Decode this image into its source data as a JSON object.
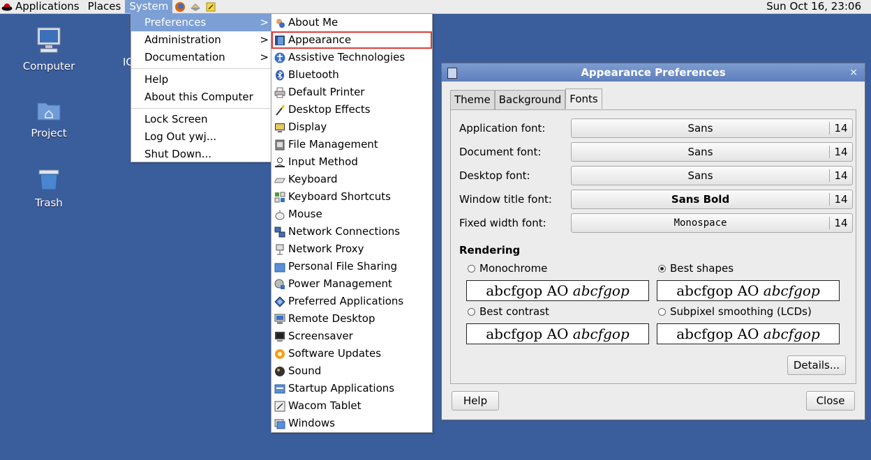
{
  "panel": {
    "applications": "Applications",
    "places": "Places",
    "system": "System",
    "clock": "Sun Oct 16, 23:06"
  },
  "desktop": {
    "icons": [
      {
        "label": "Computer",
        "icon": "computer-icon"
      },
      {
        "label": "Project",
        "icon": "folder-icon"
      },
      {
        "label": "Trash",
        "icon": "trash-icon"
      }
    ],
    "partial_label": "IC"
  },
  "system_menu": {
    "items": [
      "Preferences",
      "Administration",
      "Documentation",
      "Help",
      "About this Computer",
      "Lock Screen",
      "Log Out ywj...",
      "Shut Down..."
    ],
    "arrow": ">"
  },
  "preferences_menu": {
    "items": [
      {
        "label": "About Me",
        "icon": "about-me-icon"
      },
      {
        "label": "Appearance",
        "icon": "appearance-icon"
      },
      {
        "label": "Assistive Technologies",
        "icon": "accessibility-icon"
      },
      {
        "label": "Bluetooth",
        "icon": "bluetooth-icon"
      },
      {
        "label": "Default Printer",
        "icon": "printer-icon"
      },
      {
        "label": "Desktop Effects",
        "icon": "desktop-effects-icon"
      },
      {
        "label": "Display",
        "icon": "display-icon"
      },
      {
        "label": "File Management",
        "icon": "file-management-icon"
      },
      {
        "label": "Input Method",
        "icon": "input-method-icon"
      },
      {
        "label": "Keyboard",
        "icon": "keyboard-icon"
      },
      {
        "label": "Keyboard Shortcuts",
        "icon": "keyboard-shortcuts-icon"
      },
      {
        "label": "Mouse",
        "icon": "mouse-icon"
      },
      {
        "label": "Network Connections",
        "icon": "network-connections-icon"
      },
      {
        "label": "Network Proxy",
        "icon": "network-proxy-icon"
      },
      {
        "label": "Personal File Sharing",
        "icon": "file-sharing-icon"
      },
      {
        "label": "Power Management",
        "icon": "power-management-icon"
      },
      {
        "label": "Preferred Applications",
        "icon": "preferred-applications-icon"
      },
      {
        "label": "Remote Desktop",
        "icon": "remote-desktop-icon"
      },
      {
        "label": "Screensaver",
        "icon": "screensaver-icon"
      },
      {
        "label": "Software Updates",
        "icon": "software-updates-icon"
      },
      {
        "label": "Sound",
        "icon": "sound-icon"
      },
      {
        "label": "Startup Applications",
        "icon": "startup-applications-icon"
      },
      {
        "label": "Wacom Tablet",
        "icon": "wacom-tablet-icon"
      },
      {
        "label": "Windows",
        "icon": "windows-icon"
      }
    ]
  },
  "dialog": {
    "title": "Appearance Preferences",
    "close": "×",
    "tabs": [
      "Theme",
      "Background",
      "Fonts"
    ],
    "fonts": [
      {
        "label": "Application font:",
        "name": "Sans",
        "size": "14"
      },
      {
        "label": "Document font:",
        "name": "Sans",
        "size": "14"
      },
      {
        "label": "Desktop font:",
        "name": "Sans",
        "size": "14"
      },
      {
        "label": "Window title font:",
        "name": "Sans Bold",
        "size": "14"
      },
      {
        "label": "Fixed width font:",
        "name": "Monospace",
        "size": "14"
      }
    ],
    "rendering": {
      "heading": "Rendering",
      "options": [
        {
          "label": "Monochrome",
          "selected": false
        },
        {
          "label": "Best shapes",
          "selected": true
        },
        {
          "label": "Best contrast",
          "selected": false
        },
        {
          "label": "Subpixel smoothing (LCDs)",
          "selected": false
        }
      ],
      "sample_plain": "abcfgop AO ",
      "sample_italic": "abcfgop"
    },
    "details_button": "Details...",
    "help_button": "Help",
    "close_button": "Close"
  }
}
